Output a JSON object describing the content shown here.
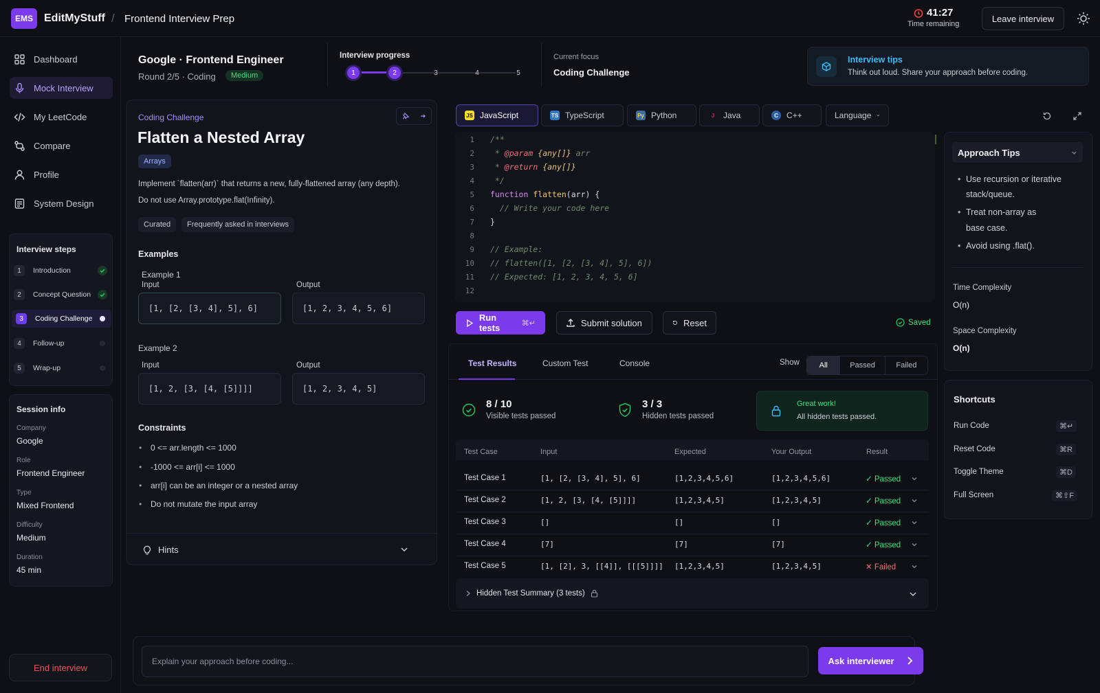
{
  "app": {
    "logo_text": "EMS",
    "brand": "EditMyStuff",
    "separator": "/",
    "page_title": "Frontend Interview Prep"
  },
  "timer": {
    "value": "41:27",
    "label": "Time remaining"
  },
  "header_actions": {
    "leave": "Leave interview",
    "theme_icon": "sun-icon"
  },
  "sidebar": {
    "nav": [
      {
        "label": "Dashboard",
        "icon": "dashboard-icon"
      },
      {
        "label": "Mock Interview",
        "icon": "microphone-icon",
        "active": true
      },
      {
        "label": "My LeetCode",
        "icon": "code-icon"
      },
      {
        "label": "Compare",
        "icon": "compare-icon"
      },
      {
        "label": "Profile",
        "icon": "user-icon"
      },
      {
        "label": "System Design",
        "icon": "layers-icon"
      }
    ],
    "steps_title": "Interview steps",
    "steps": [
      {
        "n": "1",
        "label": "Introduction",
        "status": "done"
      },
      {
        "n": "2",
        "label": "Concept Question",
        "status": "done"
      },
      {
        "n": "3",
        "label": "Coding Challenge",
        "status": "current"
      },
      {
        "n": "4",
        "label": "Follow-up",
        "status": "pending"
      },
      {
        "n": "5",
        "label": "Wrap-up",
        "status": "pending"
      }
    ],
    "session_title": "Session info",
    "session": [
      {
        "label": "Company",
        "value": "Google"
      },
      {
        "label": "Role",
        "value": "Frontend Engineer"
      },
      {
        "label": "Type",
        "value": "Mixed Frontend"
      },
      {
        "label": "Difficulty",
        "value": "Medium"
      },
      {
        "label": "Duration",
        "value": "45 min"
      }
    ],
    "end_button": "End interview"
  },
  "header": {
    "company_role": "Google · Frontend Engineer",
    "round": "Round 2/5 · Coding",
    "difficulty": "Medium",
    "progress_label": "Interview progress",
    "progress_steps": [
      "1",
      "2",
      "3",
      "4",
      "5"
    ],
    "progress_current": 2,
    "focus_label": "Current focus",
    "focus_value": "Coding Challenge",
    "tips_title": "Interview tips",
    "tips_text": "Think out loud. Share your approach before coding."
  },
  "problem": {
    "category": "Coding Challenge",
    "title": "Flatten a Nested Array",
    "tag": "Arrays",
    "description": [
      "Implement `flatten(arr)` that returns a new, fully-flattened array (any depth).",
      "Do not use Array.prototype.flat(Infinity)."
    ],
    "badges": [
      "Curated",
      "Frequently asked in interviews"
    ],
    "examples_title": "Examples",
    "examples": [
      {
        "title": "Example 1",
        "input_label": "Input",
        "input": "[1, [2, [3, 4], 5], 6]",
        "output_label": "Output",
        "output": "[1, 2, 3, 4, 5, 6]"
      },
      {
        "title": "Example 2",
        "input_label": "Input",
        "input": "[1, 2, [3, [4, [5]]]]",
        "output_label": "Output",
        "output": "[1, 2, 3, 4, 5]"
      }
    ],
    "constraints_title": "Constraints",
    "constraints": [
      "0 <= arr.length <= 1000",
      "-1000 <= arr[i] <= 1000",
      "arr[i] can be an integer or a nested array",
      "Do not mutate the input array"
    ],
    "hints": "Hints"
  },
  "editor": {
    "languages": [
      {
        "label": "JavaScript",
        "icon": "JS",
        "active": true
      },
      {
        "label": "TypeScript",
        "icon": "TS"
      },
      {
        "label": "Python",
        "icon": "Py"
      },
      {
        "label": "Java",
        "icon": "J"
      },
      {
        "label": "C++",
        "icon": "C"
      }
    ],
    "language_select": "Language",
    "line_numbers": [
      "1",
      "2",
      "3",
      "4",
      "5",
      "6",
      "7",
      "8",
      "9",
      "10",
      "11",
      "12"
    ],
    "code_lines": [
      "/**",
      " * @param {any[]} arr",
      " * @return {any[]}",
      " */",
      "function flatten(arr) {",
      "  // Write your code here",
      "}",
      "",
      "// Example:",
      "// flatten([1, [2, [3, 4], 5], 6])",
      "// Expected: [1, 2, 3, 4, 5, 6]"
    ],
    "run": "Run tests",
    "run_shortcut": "⌘↵",
    "submit": "Submit solution",
    "reset": "Reset",
    "saved": "Saved"
  },
  "results": {
    "tabs": [
      "Test Results",
      "Custom Test",
      "Console"
    ],
    "show_label": "Show",
    "filters": [
      "All",
      "Passed",
      "Failed"
    ],
    "visible_count": "8 / 10",
    "visible_label": "Visible tests passed",
    "hidden_count": "3 / 3",
    "hidden_label": "Hidden tests passed",
    "great_title": "Great work!",
    "great_text": "All hidden tests passed.",
    "columns": [
      "Test Case",
      "Input",
      "Expected",
      "Your Output",
      "Result"
    ],
    "rows": [
      {
        "name": "Test Case 1",
        "input": "[1, [2, [3, 4], 5], 6]",
        "expected": "[1,2,3,4,5,6]",
        "output": "[1,2,3,4,5,6]",
        "result": "Passed",
        "ok": true
      },
      {
        "name": "Test Case 2",
        "input": "[1, 2, [3, [4, [5]]]]",
        "expected": "[1,2,3,4,5]",
        "output": "[1,2,3,4,5]",
        "result": "Passed",
        "ok": true
      },
      {
        "name": "Test Case 3",
        "input": "[]",
        "expected": "[]",
        "output": "[]",
        "result": "Passed",
        "ok": true
      },
      {
        "name": "Test Case 4",
        "input": "[7]",
        "expected": "[7]",
        "output": "[7]",
        "result": "Passed",
        "ok": true
      },
      {
        "name": "Test Case 5",
        "input": "[1, [2], 3, [[4]], [[[5]]]]",
        "expected": "[1,2,3,4,5]",
        "output": "[1,2,3,4,5]",
        "result": "Failed",
        "ok": false
      }
    ],
    "hidden_summary": "Hidden Test Summary (3 tests)"
  },
  "right": {
    "approach_title": "Approach Tips",
    "tips": [
      "Use recursion or iterative",
      "stack/queue.",
      "Treat non-array as",
      "base case.",
      "Avoid using .flat()."
    ],
    "time_label": "Time Complexity",
    "time_value": "O(n)",
    "space_label": "Space Complexity",
    "space_value": "O(n)",
    "shortcuts_title": "Shortcuts",
    "shortcuts": [
      {
        "label": "Run Code",
        "key": "⌘↵"
      },
      {
        "label": "Reset Code",
        "key": "⌘R"
      },
      {
        "label": "Toggle Theme",
        "key": "⌘D"
      },
      {
        "label": "Full Screen",
        "key": "⌘⇧F"
      }
    ]
  },
  "ask": {
    "placeholder": "Explain your approach before coding...",
    "button": "Ask interviewer"
  },
  "colors": {
    "accent": "#7c3aed",
    "success": "#22c55e",
    "danger": "#ef4444",
    "background": "#0e1016"
  }
}
